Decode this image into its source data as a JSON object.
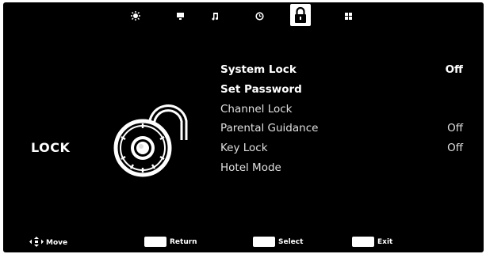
{
  "tabs": [
    {
      "name": "picture",
      "icon": "sun-icon"
    },
    {
      "name": "channel",
      "icon": "tv-icon"
    },
    {
      "name": "sound",
      "icon": "music-note-icon"
    },
    {
      "name": "time",
      "icon": "clock-icon"
    },
    {
      "name": "lock",
      "icon": "padlock-icon",
      "active": true
    },
    {
      "name": "setup",
      "icon": "grid-icon"
    }
  ],
  "section": {
    "title": "LOCK",
    "graphic_icon": "combination-lock-icon"
  },
  "menu": {
    "items": [
      {
        "label": "System Lock",
        "value": "Off"
      },
      {
        "label": "Set Password",
        "value": ""
      },
      {
        "label": "Channel Lock",
        "value": ""
      },
      {
        "label": "Parental Guidance",
        "value": "Off"
      },
      {
        "label": "Key Lock",
        "value": "Off"
      },
      {
        "label": "Hotel Mode",
        "value": ""
      }
    ]
  },
  "footer": {
    "move": "Move",
    "return": "Return",
    "select": "Select",
    "exit": "Exit"
  }
}
